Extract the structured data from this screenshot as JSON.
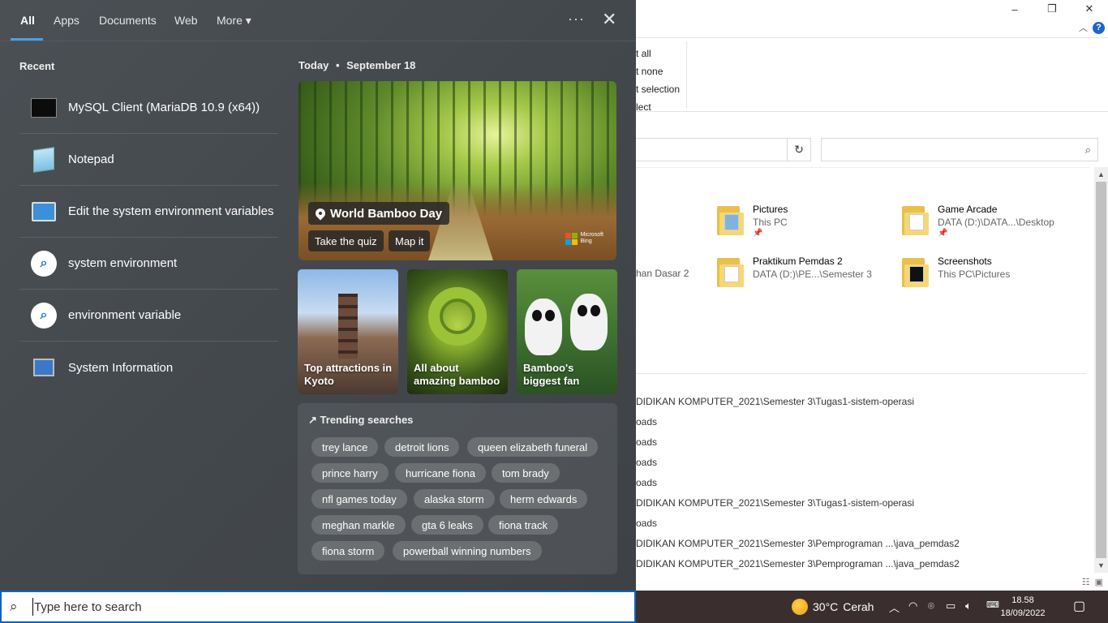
{
  "explorer": {
    "window_buttons": [
      "–",
      "❐",
      "✕"
    ],
    "ribbon_select": [
      "t all",
      "t none",
      "t selection",
      "lect"
    ],
    "quick_access": [
      {
        "name": "Pictures",
        "location": "This PC",
        "icon": "pictures-folder-icon"
      },
      {
        "name": "Game Arcade",
        "location": "DATA (D:)\\DATA...\\Desktop",
        "icon": "folder-icon"
      },
      {
        "name": "Praktikum Pemdas 2",
        "location": "DATA (D:)\\PE...\\Semester 3",
        "icon": "folder-icon"
      },
      {
        "name": "Screenshots",
        "location": "This PC\\Pictures",
        "icon": "dark-folder-icon"
      }
    ],
    "qa_fragment": "han Dasar 2",
    "recent_paths": [
      "DIDIKAN KOMPUTER_2021\\Semester 3\\Tugas1-sistem-operasi",
      "oads",
      "oads",
      "oads",
      "oads",
      "DIDIKAN KOMPUTER_2021\\Semester 3\\Tugas1-sistem-operasi",
      "oads",
      "DIDIKAN KOMPUTER_2021\\Semester 3\\Pemprograman ...\\java_pemdas2",
      "DIDIKAN KOMPUTER_2021\\Semester 3\\Pemprograman ...\\java_pemdas2"
    ]
  },
  "search_panel": {
    "tabs": [
      {
        "label": "All",
        "active": true
      },
      {
        "label": "Apps"
      },
      {
        "label": "Documents"
      },
      {
        "label": "Web"
      },
      {
        "label": "More ▾"
      }
    ],
    "more_options": "···",
    "close": "✕",
    "recent_heading": "Recent",
    "recent_items": [
      {
        "label": "MySQL Client (MariaDB 10.9 (x64))",
        "icon": "terminal-icon"
      },
      {
        "label": "Notepad",
        "icon": "notepad-icon"
      },
      {
        "label": "Edit the system environment variables",
        "icon": "system-env-icon"
      },
      {
        "label": "system environment",
        "icon": "search-icon"
      },
      {
        "label": "environment variable",
        "icon": "search-icon"
      },
      {
        "label": "System Information",
        "icon": "system-info-icon"
      }
    ],
    "today": {
      "prefix": "Today",
      "sep": "•",
      "date": "September 18"
    },
    "hero": {
      "title": "World Bamboo Day",
      "buttons": [
        "Take the quiz",
        "Map it"
      ],
      "brand_line1": "Microsoft",
      "brand_line2": "Bing"
    },
    "cards": [
      {
        "caption": "Top attractions in Kyoto"
      },
      {
        "caption": "All about amazing bamboo"
      },
      {
        "caption": "Bamboo's biggest fan"
      }
    ],
    "trending": {
      "heading": "Trending searches",
      "chips": [
        "trey lance",
        "detroit lions",
        "queen elizabeth funeral",
        "prince harry",
        "hurricane fiona",
        "tom brady",
        "nfl games today",
        "alaska storm",
        "herm edwards",
        "meghan markle",
        "gta 6 leaks",
        "fiona track",
        "fiona storm",
        "powerball winning numbers"
      ]
    },
    "search_placeholder": "Type here to search"
  },
  "taskbar": {
    "weather_temp": "30°C",
    "weather_text": "Cerah",
    "time": "18.58",
    "date": "18/09/2022"
  },
  "colors": {
    "accent": "#0a63c7",
    "tab_underline": "#4aa0e6",
    "ms_red": "#f25022",
    "ms_green": "#7fba00",
    "ms_blue": "#00a4ef",
    "ms_yellow": "#ffb900"
  }
}
